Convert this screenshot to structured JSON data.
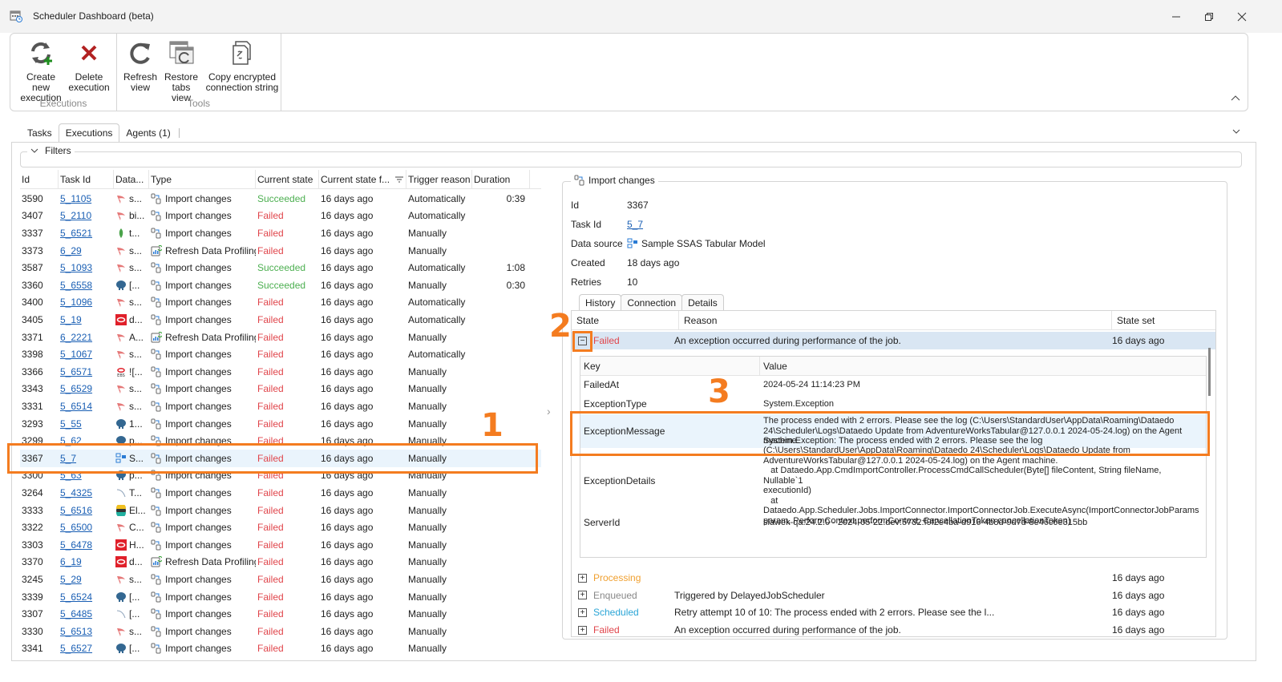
{
  "window": {
    "title": "Scheduler Dashboard (beta)",
    "minimize_icon": "minimize-icon",
    "restore_icon": "restore-icon",
    "close_icon": "close-icon"
  },
  "ribbon": {
    "groups": [
      {
        "label": "Executions",
        "buttons": [
          {
            "label_line1": "Create new",
            "label_line2": "execution",
            "icon": "create-execution-icon"
          },
          {
            "label_line1": "Delete",
            "label_line2": "execution",
            "icon": "delete-icon"
          }
        ]
      },
      {
        "label": "Tools",
        "buttons": [
          {
            "label_line1": "Refresh",
            "label_line2": "view",
            "icon": "refresh-icon"
          },
          {
            "label_line1": "Restore",
            "label_line2": "tabs view",
            "icon": "restore-tabs-icon"
          },
          {
            "label_line1": "Copy encrypted",
            "label_line2": "connection string",
            "icon": "copy-connection-icon"
          }
        ]
      }
    ]
  },
  "tabs": [
    {
      "label": "Tasks",
      "active": false
    },
    {
      "label": "Executions",
      "active": true
    },
    {
      "label": "Agents (1)",
      "active": false
    }
  ],
  "filters": {
    "label": "Filters"
  },
  "grid": {
    "columns": [
      "Id",
      "Task Id",
      "Data...",
      "Type",
      "Current state",
      "Current state f...",
      "Trigger reason",
      "Duration"
    ],
    "rows": [
      {
        "id": "3590",
        "task": "5_1105",
        "ds_icon": "sqlserver",
        "ds": "s...",
        "type": "Import changes",
        "state": "Succeeded",
        "from": "16 days ago",
        "trigger": "Automatically",
        "duration": "0:39"
      },
      {
        "id": "3407",
        "task": "5_2110",
        "ds_icon": "sqlserver",
        "ds": "bi...",
        "type": "Import changes",
        "state": "Failed",
        "from": "16 days ago",
        "trigger": "Automatically",
        "duration": ""
      },
      {
        "id": "3337",
        "task": "5_6521",
        "ds_icon": "mongodb",
        "ds": "t...",
        "type": "Import changes",
        "state": "Failed",
        "from": "16 days ago",
        "trigger": "Manually",
        "duration": ""
      },
      {
        "id": "3373",
        "task": "6_29",
        "ds_icon": "sqlserver",
        "ds": "s...",
        "type": "Refresh Data Profiling",
        "state": "Failed",
        "from": "16 days ago",
        "trigger": "Manually",
        "duration": ""
      },
      {
        "id": "3587",
        "task": "5_1093",
        "ds_icon": "sqlserver",
        "ds": "s...",
        "type": "Import changes",
        "state": "Succeeded",
        "from": "16 days ago",
        "trigger": "Automatically",
        "duration": "1:08"
      },
      {
        "id": "3360",
        "task": "5_6558",
        "ds_icon": "postgres",
        "ds": "[...",
        "type": "Import changes",
        "state": "Succeeded",
        "from": "16 days ago",
        "trigger": "Manually",
        "duration": "0:30"
      },
      {
        "id": "3400",
        "task": "5_1096",
        "ds_icon": "sqlserver",
        "ds": "s...",
        "type": "Import changes",
        "state": "Failed",
        "from": "16 days ago",
        "trigger": "Automatically",
        "duration": ""
      },
      {
        "id": "3405",
        "task": "5_19",
        "ds_icon": "oracle",
        "ds": "d...",
        "type": "Import changes",
        "state": "Failed",
        "from": "16 days ago",
        "trigger": "Automatically",
        "duration": ""
      },
      {
        "id": "3371",
        "task": "6_2221",
        "ds_icon": "sqlserver",
        "ds": "A...",
        "type": "Refresh Data Profiling",
        "state": "Failed",
        "from": "16 days ago",
        "trigger": "Manually",
        "duration": ""
      },
      {
        "id": "3398",
        "task": "5_1067",
        "ds_icon": "sqlserver",
        "ds": "s...",
        "type": "Import changes",
        "state": "Failed",
        "from": "16 days ago",
        "trigger": "Automatically",
        "duration": ""
      },
      {
        "id": "3366",
        "task": "5_6571",
        "ds_icon": "oracle-ebs",
        "ds": "![...",
        "type": "Import changes",
        "state": "Failed",
        "from": "16 days ago",
        "trigger": "Manually",
        "duration": ""
      },
      {
        "id": "3343",
        "task": "5_6529",
        "ds_icon": "sqlserver",
        "ds": "s...",
        "type": "Import changes",
        "state": "Failed",
        "from": "16 days ago",
        "trigger": "Manually",
        "duration": ""
      },
      {
        "id": "3331",
        "task": "5_6514",
        "ds_icon": "sqlserver",
        "ds": "s...",
        "type": "Import changes",
        "state": "Failed",
        "from": "16 days ago",
        "trigger": "Manually",
        "duration": ""
      },
      {
        "id": "3293",
        "task": "5_55",
        "ds_icon": "postgres",
        "ds": "1...",
        "type": "Import changes",
        "state": "Failed",
        "from": "16 days ago",
        "trigger": "Manually",
        "duration": ""
      },
      {
        "id": "3299",
        "task": "5_62",
        "ds_icon": "postgres",
        "ds": "p...",
        "type": "Import changes",
        "state": "Failed",
        "from": "16 days ago",
        "trigger": "Manually",
        "duration": ""
      },
      {
        "id": "3367",
        "task": "5_7",
        "ds_icon": "ssas",
        "ds": "S...",
        "type": "Import changes",
        "state": "Failed",
        "from": "16 days ago",
        "trigger": "Manually",
        "duration": "",
        "selected": true
      },
      {
        "id": "3300",
        "task": "5_63",
        "ds_icon": "postgres",
        "ds": "p...",
        "type": "Import changes",
        "state": "Failed",
        "from": "16 days ago",
        "trigger": "Manually",
        "duration": ""
      },
      {
        "id": "3264",
        "task": "5_4325",
        "ds_icon": "mysql",
        "ds": "T...",
        "type": "Import changes",
        "state": "Failed",
        "from": "16 days ago",
        "trigger": "Manually",
        "duration": ""
      },
      {
        "id": "3333",
        "task": "5_6516",
        "ds_icon": "elastic",
        "ds": "El...",
        "type": "Import changes",
        "state": "Failed",
        "from": "16 days ago",
        "trigger": "Manually",
        "duration": ""
      },
      {
        "id": "3322",
        "task": "5_6500",
        "ds_icon": "sqlserver",
        "ds": "C...",
        "type": "Import changes",
        "state": "Failed",
        "from": "16 days ago",
        "trigger": "Manually",
        "duration": ""
      },
      {
        "id": "3303",
        "task": "5_6478",
        "ds_icon": "oracle",
        "ds": "H...",
        "type": "Import changes",
        "state": "Failed",
        "from": "16 days ago",
        "trigger": "Manually",
        "duration": ""
      },
      {
        "id": "3370",
        "task": "6_19",
        "ds_icon": "oracle",
        "ds": "d...",
        "type": "Refresh Data Profiling",
        "state": "Failed",
        "from": "16 days ago",
        "trigger": "Manually",
        "duration": ""
      },
      {
        "id": "3245",
        "task": "5_29",
        "ds_icon": "sqlserver",
        "ds": "s...",
        "type": "Import changes",
        "state": "Failed",
        "from": "16 days ago",
        "trigger": "Manually",
        "duration": ""
      },
      {
        "id": "3339",
        "task": "5_6524",
        "ds_icon": "postgres",
        "ds": "[...",
        "type": "Import changes",
        "state": "Failed",
        "from": "16 days ago",
        "trigger": "Manually",
        "duration": ""
      },
      {
        "id": "3307",
        "task": "5_6485",
        "ds_icon": "mysql",
        "ds": "[...",
        "type": "Import changes",
        "state": "Failed",
        "from": "16 days ago",
        "trigger": "Manually",
        "duration": ""
      },
      {
        "id": "3330",
        "task": "5_6513",
        "ds_icon": "sqlserver",
        "ds": "s...",
        "type": "Import changes",
        "state": "Failed",
        "from": "16 days ago",
        "trigger": "Manually",
        "duration": ""
      },
      {
        "id": "3341",
        "task": "5_6527",
        "ds_icon": "postgres",
        "ds": "[...",
        "type": "Import changes",
        "state": "Failed",
        "from": "16 days ago",
        "trigger": "Manually",
        "duration": ""
      }
    ]
  },
  "detail": {
    "title": "Import changes",
    "fields": {
      "id_label": "Id",
      "id_value": "3367",
      "task_label": "Task Id",
      "task_value": "5_7",
      "ds_label": "Data source",
      "ds_value": "Sample SSAS Tabular Model",
      "created_label": "Created",
      "created_value": "18 days ago",
      "retries_label": "Retries",
      "retries_value": "10"
    },
    "tabs": [
      {
        "label": "History",
        "active": true
      },
      {
        "label": "Connection",
        "active": false
      },
      {
        "label": "Details",
        "active": false
      }
    ],
    "history": {
      "columns": [
        "State",
        "Reason",
        "State set"
      ],
      "expanded": {
        "state": "Failed",
        "reason": "An exception occurred during performance of the job.",
        "time": "16 days ago"
      },
      "kv_columns": [
        "Key",
        "Value"
      ],
      "kv": [
        {
          "key": "FailedAt",
          "value": "2024-05-24 11:14:23 PM"
        },
        {
          "key": "ExceptionType",
          "value": "System.Exception"
        },
        {
          "key": "ExceptionMessage",
          "value": "The process ended with 2 errors. Please see the log (C:\\Users\\StandardUser\\AppData\\Roaming\\Dataedo 24\\Scheduler\\Logs\\Dataedo Update from AdventureWorksTabular@127.0.0.1 2024-05-24.log) on the Agent machine."
        },
        {
          "key": "ExceptionDetails",
          "value": "System.Exception: The process ended with 2 errors. Please see the log\n(C:\\Users\\StandardUser\\AppData\\Roaming\\Dataedo 24\\Scheduler\\Logs\\Dataedo Update from\nAdventureWorksTabular@127.0.0.1 2024-05-24.log) on the Agent machine.\n   at Dataedo.App.CmdImportController.ProcessCmdCallScheduler(Byte[] fileContent, String fileName, Nullable`1\nexecutionId)\n   at\nDataedo.App.Scheduler.Jobs.ImportConnector.ImportConnectorJob.ExecuteAsync(ImportConnectorJobParams\nparam, PerformContext performContext, CancellationToken cancellationToken)"
        },
        {
          "key": "ServerId",
          "value": "slawek-qa:24.2.0 - 2024-05-22.dev:5732:f9f2e4ba-d916-4b8d-9d7d-8e46c0e315bb"
        }
      ],
      "rows": [
        {
          "state": "Processing",
          "reason": "",
          "time": "16 days ago"
        },
        {
          "state": "Enqueued",
          "reason": "Triggered by DelayedJobScheduler",
          "time": "16 days ago"
        },
        {
          "state": "Scheduled",
          "reason": "Retry attempt 10 of 10: The process ended with 2 errors. Please see the l...",
          "time": "16 days ago"
        },
        {
          "state": "Failed",
          "reason": "An exception occurred during performance of the job.",
          "time": "16 days ago"
        }
      ]
    }
  },
  "annotations": [
    {
      "number": "1",
      "target": "selected-grid-row"
    },
    {
      "number": "2",
      "target": "expand-toggle"
    },
    {
      "number": "3",
      "target": "exception-message-row"
    }
  ],
  "colors": {
    "accent_annotation": "#f47c20",
    "succeeded": "#4caf50",
    "failed": "#e0454b",
    "processing": "#f0a030",
    "scheduled": "#2aa5d6",
    "link": "#1a5fb4"
  }
}
